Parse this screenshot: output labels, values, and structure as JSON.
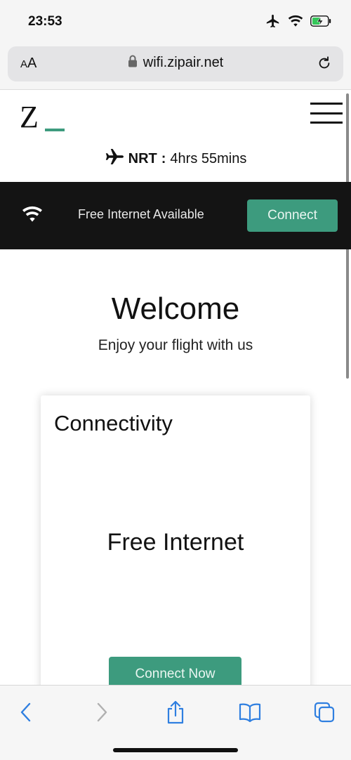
{
  "status_bar": {
    "time": "23:53",
    "icons": [
      "airplane-mode-icon",
      "wifi-icon",
      "battery-charging-icon"
    ]
  },
  "browser": {
    "text_size_label_small": "A",
    "text_size_label_large": "A",
    "url": "wifi.zipair.net",
    "toolbar_icons": [
      "back-icon",
      "forward-icon",
      "share-icon",
      "bookmarks-icon",
      "tabs-icon"
    ]
  },
  "header": {
    "logo_letter": "Z",
    "menu_icon": "hamburger-menu-icon"
  },
  "flight": {
    "destination_code": "NRT",
    "separator": ":",
    "remaining_time": "4hrs 55mins"
  },
  "banner": {
    "text": "Free Internet Available",
    "connect_label": "Connect"
  },
  "welcome": {
    "title": "Welcome",
    "subtitle": "Enjoy your flight with us"
  },
  "card": {
    "title": "Connectivity",
    "plan_name": "Free Internet",
    "connect_label": "Connect Now"
  },
  "colors": {
    "accent": "#3d9b7e",
    "banner_bg": "#141414",
    "ios_blue": "#2f7fe0",
    "inactive": "#b0b0b0"
  }
}
